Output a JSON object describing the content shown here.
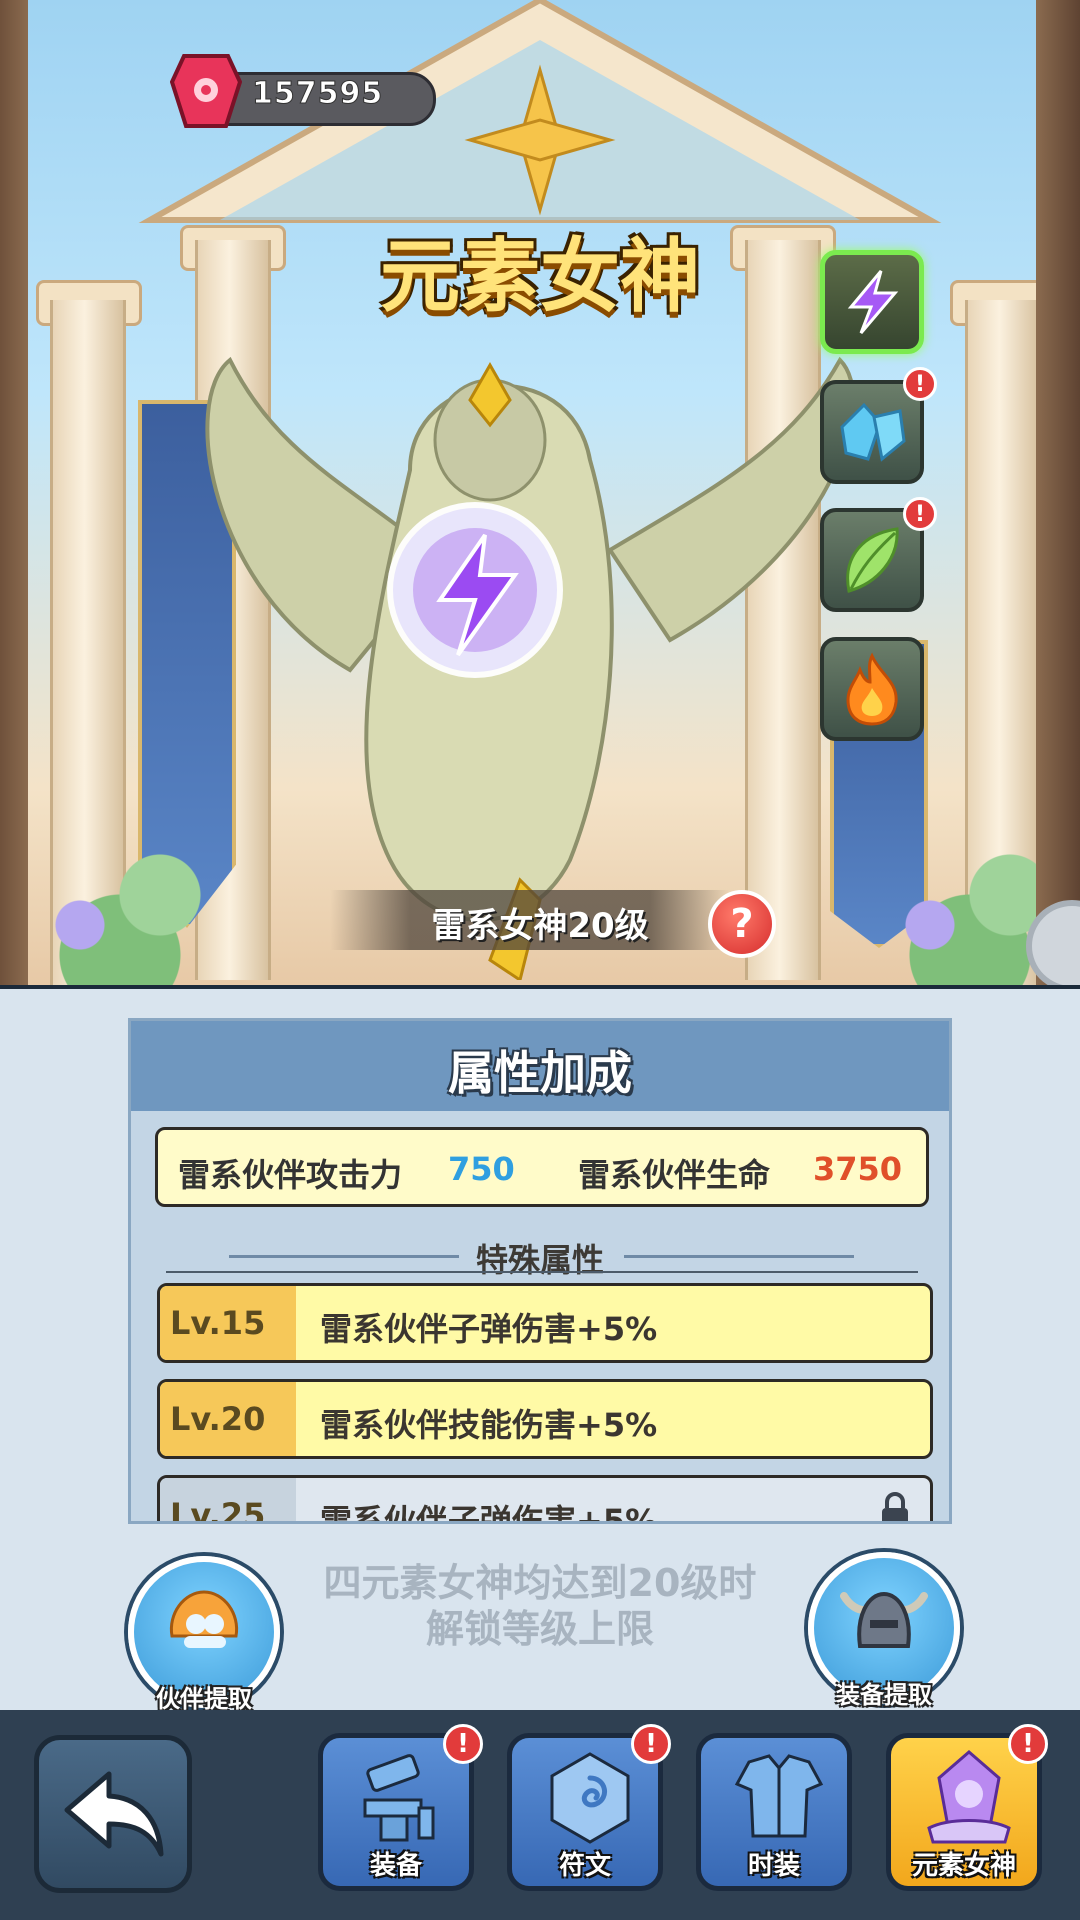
{
  "currency": {
    "gems": "157595"
  },
  "title": "元素女神",
  "elements": [
    {
      "name": "lightning",
      "active": true,
      "alert": false
    },
    {
      "name": "ice",
      "active": false,
      "alert": true
    },
    {
      "name": "wind",
      "active": false,
      "alert": true
    },
    {
      "name": "fire",
      "active": false,
      "alert": false
    }
  ],
  "level_caption": "雷系女神20级",
  "help_label": "?",
  "alert_mark": "!",
  "panel": {
    "title": "属性加成",
    "stats": [
      {
        "label": "雷系伙伴攻击力",
        "value": "750",
        "color": "#2f9fe0"
      },
      {
        "label": "雷系伙伴生命",
        "value": "3750",
        "color": "#e0502a"
      }
    ],
    "special_title": "特殊属性",
    "levels": [
      {
        "level": "Lv.15",
        "desc": "雷系伙伴子弹伤害+5%"
      },
      {
        "level": "Lv.20",
        "desc": "雷系伙伴技能伤害+5%"
      },
      {
        "level": "Lv.25",
        "desc": "雷系伙伴子弹伤害+5%"
      }
    ]
  },
  "unlock_text": [
    "四元素女神均达到20级时",
    "解锁等级上限"
  ],
  "buttons": {
    "partner_extract": "伙伴提取",
    "equipment_extract": "装备提取"
  },
  "nav": {
    "tabs": [
      {
        "label": "装备",
        "alert": true
      },
      {
        "label": "符文",
        "alert": true
      },
      {
        "label": "时装",
        "alert": false
      },
      {
        "label": "元素女神",
        "alert": true,
        "active": true
      }
    ]
  }
}
